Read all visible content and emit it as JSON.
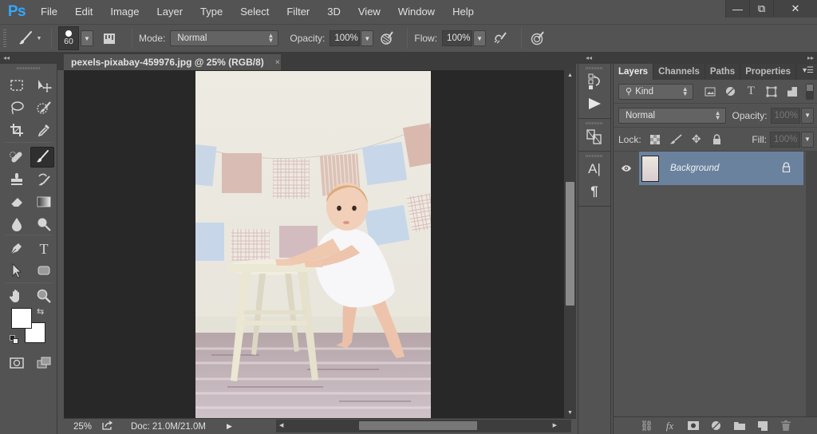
{
  "app": {
    "logo": "Ps",
    "name": "Photoshop"
  },
  "menu": [
    "File",
    "Edit",
    "Image",
    "Layer",
    "Type",
    "Select",
    "Filter",
    "3D",
    "View",
    "Window",
    "Help"
  ],
  "window_controls": {
    "minimize": "—",
    "restore": "⧉",
    "close": "✕"
  },
  "options_bar": {
    "tool_icon": "brush-icon",
    "brush_size": "60",
    "mode_label": "Mode:",
    "mode_value": "Normal",
    "opacity_label": "Opacity:",
    "opacity_value": "100%",
    "flow_label": "Flow:",
    "flow_value": "100%"
  },
  "document": {
    "tab_title": "pexels-pixabay-459976.jpg @ 25% (RGB/8)",
    "tab_close": "×",
    "image_description": "Baby standing holding a white wooden stool in front of a pastel bunting garland"
  },
  "status_bar": {
    "zoom": "25%",
    "doc_info": "Doc: 21.0M/21.0M"
  },
  "tools": [
    "rectangular-marquee",
    "move",
    "lasso",
    "quick-selection",
    "crop",
    "eyedropper",
    "spot-healing-brush",
    "brush",
    "clone-stamp",
    "history-brush",
    "eraser",
    "gradient",
    "blur",
    "dodge",
    "pen",
    "type",
    "path-selection",
    "rectangle",
    "hand",
    "zoom"
  ],
  "active_tool": "brush",
  "colors": {
    "foreground": "#ffffff",
    "background": "#ffffff",
    "accent_logo": "#31a8ff",
    "selected_layer": "#6b829e"
  },
  "layers_panel": {
    "tabs": [
      {
        "label": "Layers",
        "active": true
      },
      {
        "label": "Channels",
        "active": false
      },
      {
        "label": "Paths",
        "active": false
      },
      {
        "label": "Properties",
        "active": false
      }
    ],
    "filter_kind": "Kind",
    "blend_mode": "Normal",
    "opacity_label": "Opacity:",
    "opacity_value": "100%",
    "lock_label": "Lock:",
    "fill_label": "Fill:",
    "fill_value": "100%",
    "layers": [
      {
        "name": "Background",
        "visible": true,
        "locked": true,
        "selected": true
      }
    ]
  }
}
